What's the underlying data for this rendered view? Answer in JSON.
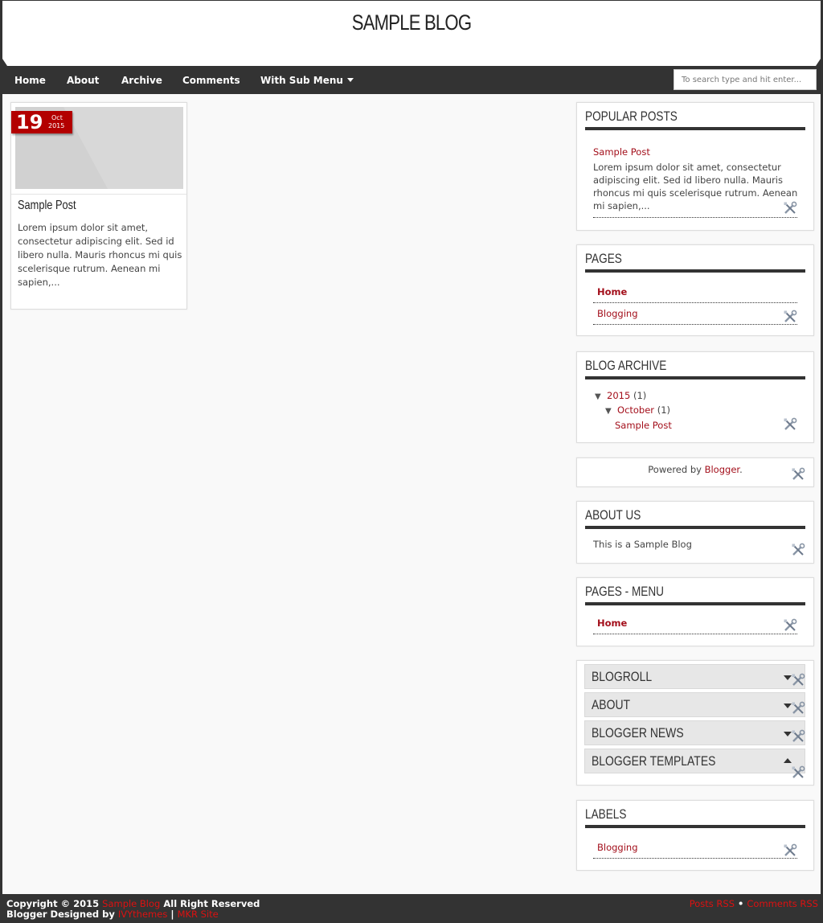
{
  "header": {
    "title": "SAMPLE BLOG"
  },
  "nav": {
    "items": [
      "Home",
      "About",
      "Archive",
      "Comments",
      "With Sub Menu"
    ],
    "search_placeholder": "To search type and hit enter..."
  },
  "post": {
    "day": "19",
    "month": "Oct",
    "year": "2015",
    "title": "Sample Post",
    "snippet": "Lorem ipsum dolor sit amet, consectetur adipiscing elit. Sed id libero nulla. Mauris rhoncus mi quis scelerisque rutrum. Aenean mi sapien,..."
  },
  "sidebar": {
    "popular": {
      "title": "Popular Posts",
      "post_title": "Sample Post",
      "snippet": "Lorem ipsum dolor sit amet, consectetur adipiscing elit. Sed id libero nulla. Mauris rhoncus mi quis scelerisque rutrum. Aenean mi sapien,..."
    },
    "pages": {
      "title": "Pages",
      "items": [
        "Home",
        "Blogging"
      ]
    },
    "archive": {
      "title": "Blog Archive",
      "year": "2015",
      "year_count": "(1)",
      "month": "October",
      "month_count": "(1)",
      "post": "Sample Post"
    },
    "powered": {
      "prefix": "Powered by",
      "link": "Blogger",
      "suffix": "."
    },
    "about": {
      "title": "About Us",
      "text": "This is a Sample Blog"
    },
    "pages_menu": {
      "title": "Pages - Menu",
      "items": [
        "Home"
      ]
    },
    "collapsibles": [
      "BLOGROLL",
      "ABOUT",
      "BLOGGER NEWS",
      "BLOGGER TEMPLATES"
    ],
    "labels": {
      "title": "Labels",
      "items": [
        "Blogging"
      ]
    }
  },
  "footer": {
    "copyright_prefix": "Copyright © 2015",
    "blog_link": "Sample Blog",
    "rights": "All Right Reserved",
    "designed_by": "Blogger Designed by",
    "ivy_link": "IVYthemes",
    "sep": "|",
    "mkr_link": "MKR Site",
    "posts_rss": "Posts RSS",
    "bullet": "•",
    "comments_rss": "Comments RSS"
  },
  "colors": {
    "accent": "#b30000",
    "link": "#a30f1b",
    "dark": "#333333"
  }
}
